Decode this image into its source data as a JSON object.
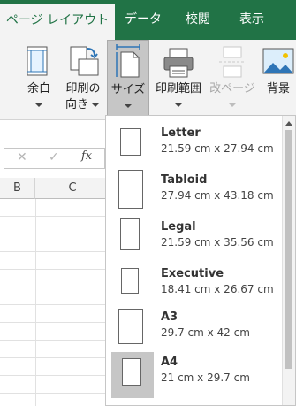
{
  "ribbon_tabs": [
    {
      "label": "ページ レイアウト",
      "active": true
    },
    {
      "label": "データ",
      "active": false
    },
    {
      "label": "校閲",
      "active": false
    },
    {
      "label": "表示",
      "active": false
    }
  ],
  "ribbon_buttons": {
    "margins": {
      "label": "余白",
      "icon": "margins-icon"
    },
    "orientation": {
      "label_line1": "印刷の",
      "label_line2": "向き",
      "icon": "orientation-icon"
    },
    "size": {
      "label": "サイズ",
      "icon": "page-size-icon",
      "pressed": true
    },
    "print_area": {
      "label": "印刷範囲",
      "icon": "print-area-icon"
    },
    "breaks": {
      "label": "改ページ",
      "icon": "page-break-icon",
      "disabled": true
    },
    "background": {
      "label": "背景",
      "icon": "background-image-icon"
    }
  },
  "formula_bar": {
    "cancel_symbol": "✕",
    "enter_symbol": "✓",
    "fx_symbol": "fx"
  },
  "column_headers": [
    "B",
    "C"
  ],
  "paper_sizes": [
    {
      "name": "Letter",
      "dimensions": "21.59 cm x 27.94 cm",
      "selected": false
    },
    {
      "name": "Tabloid",
      "dimensions": "27.94 cm x 43.18 cm",
      "selected": false
    },
    {
      "name": "Legal",
      "dimensions": "21.59 cm x 35.56 cm",
      "selected": false
    },
    {
      "name": "Executive",
      "dimensions": "18.41 cm x 26.67 cm",
      "selected": false
    },
    {
      "name": "A3",
      "dimensions": "29.7 cm x 42 cm",
      "selected": false
    },
    {
      "name": "A4",
      "dimensions": "21 cm x 29.7 cm",
      "selected": true
    }
  ],
  "colors": {
    "excel_green": "#217346",
    "ribbon_bg": "#f3f3f3",
    "selected_bg": "#c6c6c6"
  }
}
